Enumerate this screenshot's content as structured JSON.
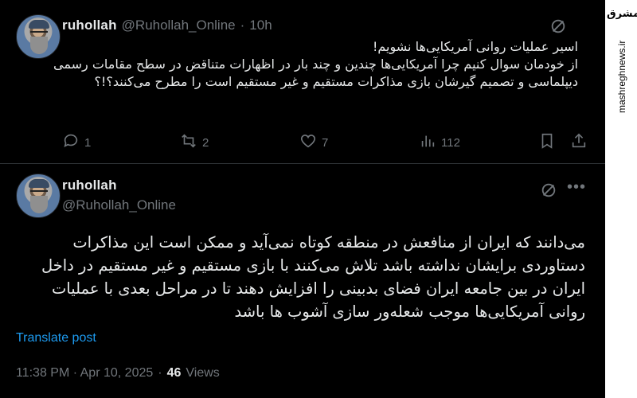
{
  "tweet1": {
    "display_name": "ruhollah",
    "handle": "@Ruhollah_Online",
    "separator": "·",
    "time": "10h",
    "body": "اسیر عملیات روانی آمریکایی‌ها نشویم!\nاز خودمان سوال کنیم چرا آمریکایی‌ها چندین و چند بار در اظهارات متناقض در سطح مقامات رسمی دیپلماسی و تصمیم گیرشان بازی مذاکرات مستقیم و غیر مستقیم است را مطرح می‌کنند؟!؟",
    "actions": {
      "replies": "1",
      "reposts": "2",
      "likes": "7",
      "views": "112"
    }
  },
  "tweet2": {
    "display_name": "ruhollah",
    "handle": "@Ruhollah_Online",
    "body": "می‌دانند که ایران از منافعش در منطقه کوتاه نمی‌آید و ممکن است این مذاکرات دستاوردی برایشان نداشته باشد تلاش می‌کنند با بازی مستقیم و غیر مستقیم در داخل ایران در بین جامعه ایران فضای بدبینی را افزایش دهند تا در مراحل بعدی با عملیات روانی آمریکایی‌ها موجب شعله‌ور سازی آشوب ها باشد",
    "translate_label": "Translate post",
    "timestamp": "11:38 PM · Apr 10, 2025",
    "separator": "·",
    "views_count": "46",
    "views_label": "Views"
  },
  "watermark": {
    "logo_text": "مشرق",
    "url": "mashreghnews.ir"
  },
  "colors": {
    "background": "#000000",
    "text": "#e7e9ea",
    "muted": "#71767b",
    "link": "#1d9bf0",
    "divider": "#2f3336"
  },
  "icons": {
    "reply": "reply-icon",
    "repost": "repost-icon",
    "like": "heart-icon",
    "views": "views-icon",
    "bookmark": "bookmark-icon",
    "share": "share-icon",
    "grok": "grok-icon",
    "more": "more-icon"
  }
}
